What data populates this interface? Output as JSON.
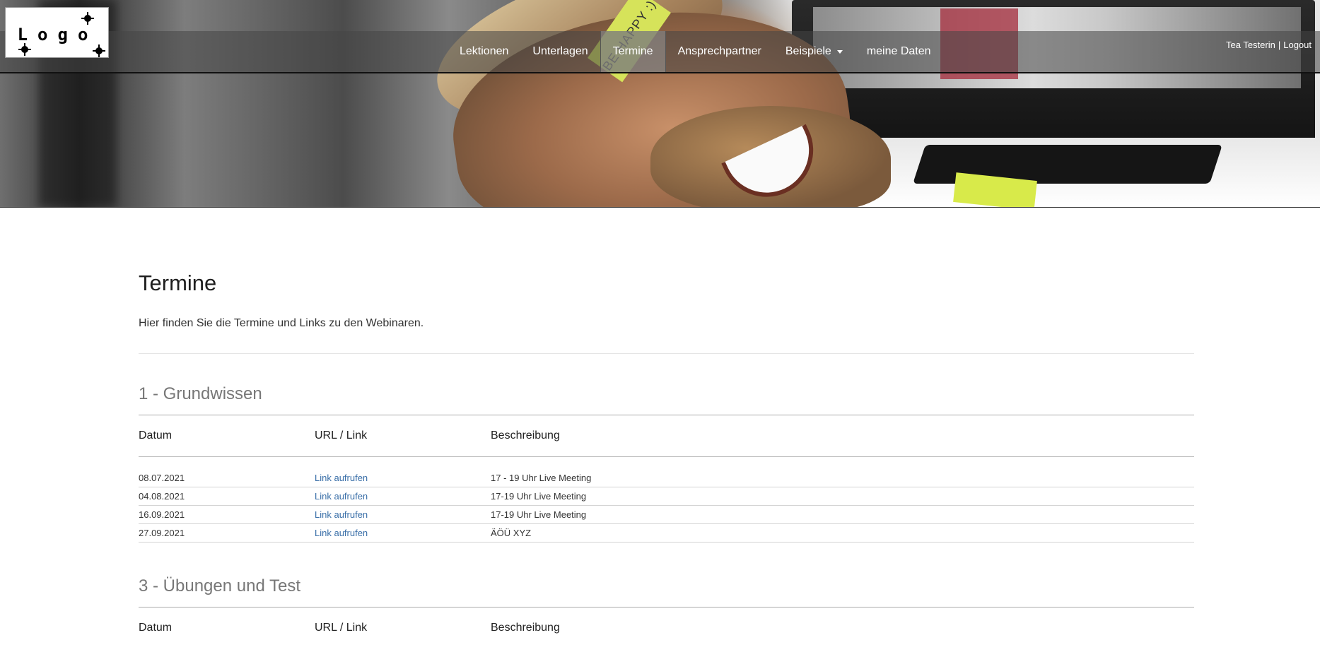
{
  "logo": {
    "text": "Logo"
  },
  "nav": {
    "items": [
      {
        "label": "Lektionen",
        "active": false
      },
      {
        "label": "Unterlagen",
        "active": false
      },
      {
        "label": "Termine",
        "active": true
      },
      {
        "label": "Ansprechpartner",
        "active": false
      },
      {
        "label": "Beispiele",
        "active": false,
        "dropdown": true
      },
      {
        "label": "meine Daten",
        "active": false
      }
    ]
  },
  "user": {
    "name": "Tea Testerin",
    "separator": "|",
    "logout": "Logout"
  },
  "hero": {
    "sticky_note": "BE HAPPY :)"
  },
  "page": {
    "title": "Termine",
    "intro": "Hier finden Sie die Termine und Links zu den Webinaren."
  },
  "sections": [
    {
      "title": "1 - Grundwissen",
      "headers": {
        "date": "Datum",
        "link": "URL / Link",
        "desc": "Beschreibung"
      },
      "rows": [
        {
          "date": "08.07.2021",
          "link": "Link aufrufen",
          "desc": "17 - 19 Uhr Live Meeting"
        },
        {
          "date": "04.08.2021",
          "link": "Link aufrufen",
          "desc": "17-19 Uhr Live Meeting"
        },
        {
          "date": "16.09.2021",
          "link": "Link aufrufen",
          "desc": "17-19 Uhr Live Meeting"
        },
        {
          "date": "27.09.2021",
          "link": "Link aufrufen",
          "desc": "ÄÖÜ XYZ"
        }
      ]
    },
    {
      "title": "3 - Übungen und Test",
      "headers": {
        "date": "Datum",
        "link": "URL / Link",
        "desc": "Beschreibung"
      },
      "rows": []
    }
  ],
  "colors": {
    "link": "#3a6fa8",
    "section_title": "#777777",
    "nav_text": "#ffffff"
  }
}
